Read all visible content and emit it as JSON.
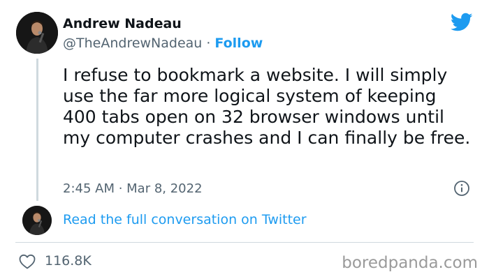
{
  "author": {
    "name": "Andrew Nadeau",
    "handle": "@TheAndrewNadeau",
    "separator": "·",
    "follow_label": "Follow"
  },
  "tweet": {
    "text": "I refuse to bookmark a website. I will simply use the far more logical system of keeping 400 tabs open on 32 browser windows until my computer crashes and I can finally be free.",
    "timestamp": "2:45 AM · Mar 8, 2022"
  },
  "conversation_link": "Read the full conversation on Twitter",
  "stats": {
    "likes": "116.8K"
  },
  "watermark": "boredpanda.com",
  "icons": {
    "brand": "twitter-bird-icon",
    "info": "info-icon",
    "like": "heart-icon"
  },
  "colors": {
    "accent": "#1d9bf0",
    "secondary_text": "#536471",
    "primary_text": "#0f1419",
    "divider": "#cfd9de",
    "watermark": "#9a9a9a"
  }
}
